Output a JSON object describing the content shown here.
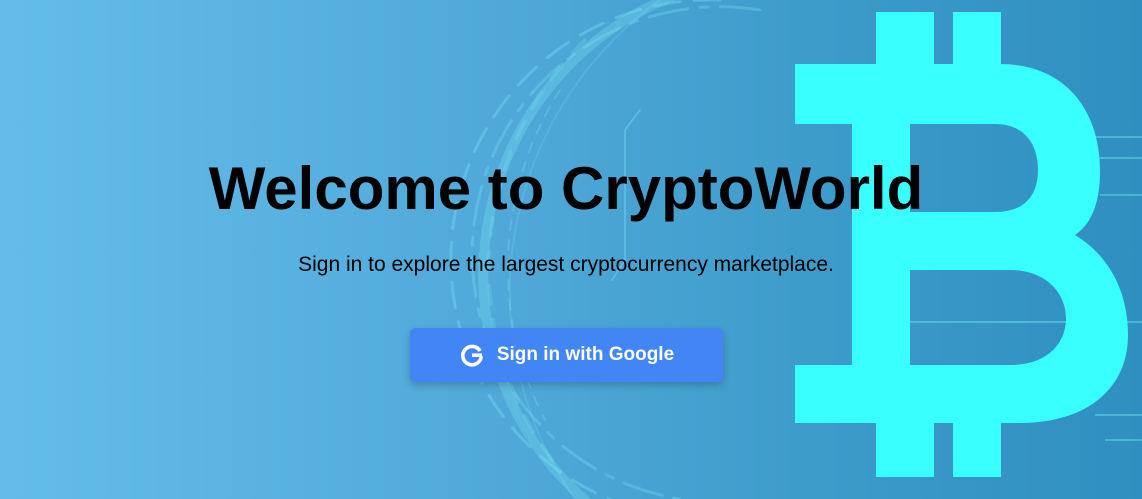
{
  "hero": {
    "title": "Welcome to CryptoWorld",
    "subtitle": "Sign in to explore the largest cryptocurrency marketplace."
  },
  "signin": {
    "button_label": "Sign in with Google",
    "icon": "google-g-icon"
  },
  "background": {
    "gradient_start": "#64bde9",
    "gradient_end": "#2f8fc0",
    "bitcoin_symbol_color": "#38fefe",
    "decor_line_color": "#6fe4f2",
    "icon": "bitcoin-icon"
  },
  "colors": {
    "button": "#4285f4",
    "title_text": "#000000",
    "button_text": "#ffffff"
  }
}
